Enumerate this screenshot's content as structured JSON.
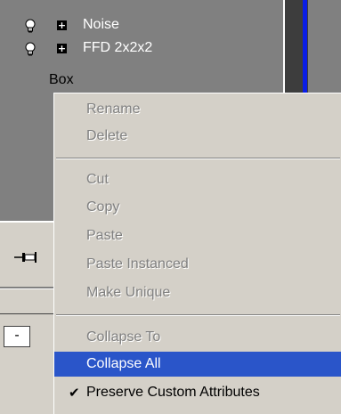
{
  "stack": {
    "items": [
      {
        "label": "Noise",
        "icon": "lightbulb-icon",
        "expander": "+"
      },
      {
        "label": "FFD 2x2x2",
        "icon": "lightbulb-icon",
        "expander": "+"
      },
      {
        "label": "Box"
      }
    ]
  },
  "panel": {
    "pin_icon": "pin-icon",
    "minus_label": "-"
  },
  "context_menu": {
    "items": [
      {
        "label": "Rename",
        "state": "disabled"
      },
      {
        "label": "Delete",
        "state": "disabled"
      },
      {
        "label": "Cut",
        "state": "disabled"
      },
      {
        "label": "Copy",
        "state": "disabled"
      },
      {
        "label": "Paste",
        "state": "disabled"
      },
      {
        "label": "Paste Instanced",
        "state": "disabled"
      },
      {
        "label": "Make Unique",
        "state": "disabled"
      },
      {
        "label": "Collapse To",
        "state": "disabled"
      },
      {
        "label": "Collapse All",
        "state": "highlighted"
      },
      {
        "label": "Preserve Custom Attributes",
        "state": "checked",
        "check": "✔"
      }
    ]
  },
  "colors": {
    "highlight": "#2a55c9",
    "menu_bg": "#d4d0c8",
    "disabled_text": "#808080",
    "accent_blue": "#0a1ee6"
  }
}
